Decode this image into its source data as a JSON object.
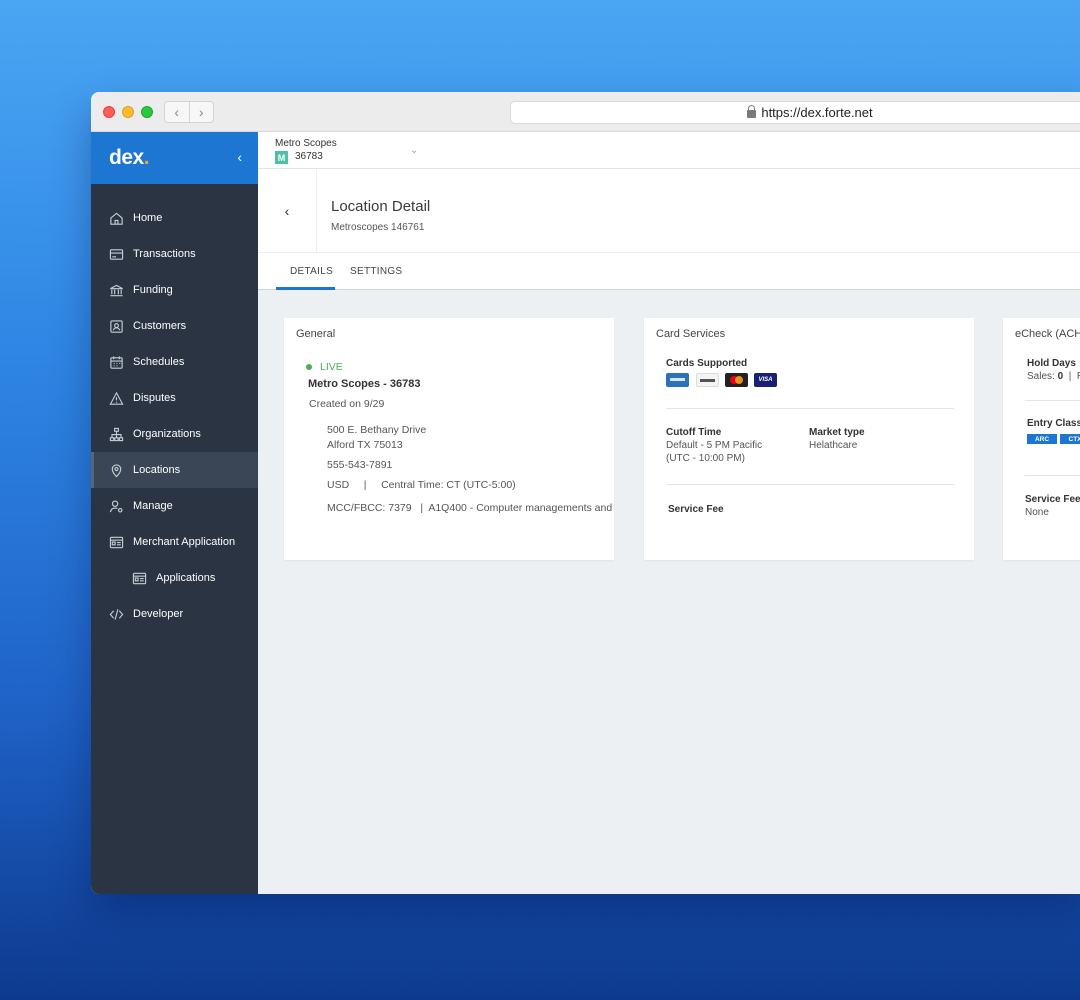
{
  "browser": {
    "url": "https://dex.forte.net",
    "back_glyph": "‹",
    "forward_glyph": "›"
  },
  "sidebar": {
    "brand": "dex",
    "brand_accent": ".",
    "collapse_glyph": "‹",
    "items": [
      {
        "label": "Home",
        "icon": "home-icon"
      },
      {
        "label": "Transactions",
        "icon": "credit-card-icon"
      },
      {
        "label": "Funding",
        "icon": "bank-icon"
      },
      {
        "label": "Customers",
        "icon": "contacts-icon"
      },
      {
        "label": "Schedules",
        "icon": "calendar-icon"
      },
      {
        "label": "Disputes",
        "icon": "warning-icon"
      },
      {
        "label": "Organizations",
        "icon": "hierarchy-icon"
      },
      {
        "label": "Locations",
        "icon": "map-pin-icon"
      },
      {
        "label": "Manage",
        "icon": "user-gear-icon"
      },
      {
        "label": "Merchant Application",
        "icon": "form-icon"
      },
      {
        "label": "Applications",
        "icon": "form-icon"
      },
      {
        "label": "Developer",
        "icon": "code-icon"
      }
    ],
    "active": "Locations"
  },
  "merchant": {
    "name": "Metro Scopes",
    "badge": "M",
    "id": "36783",
    "chevron": "⌄"
  },
  "header": {
    "back_glyph": "‹",
    "title": "Location Detail",
    "subtitle": "Metroscopes 146761"
  },
  "tabs": [
    {
      "label": "DETAILS",
      "active": true
    },
    {
      "label": "SETTINGS",
      "active": false
    }
  ],
  "general": {
    "title": "General",
    "status": "LIVE",
    "name": "Metro Scopes - 36783",
    "created": "Created on 9/29",
    "address1": "500 E. Bethany Drive",
    "address2": "Alford TX 75013",
    "phone": "555-543-7891",
    "currency_tz": "USD     |     Central Time: CT (UTC-5:00)",
    "mcc": "MCC/FBCC: 7379   |  A1Q400 - Computer managements and"
  },
  "card_services": {
    "title": "Card Services",
    "cards_label": "Cards Supported",
    "cards": [
      "amex",
      "discover",
      "mastercard",
      "visa"
    ],
    "visa_text": "VISA",
    "cutoff_label": "Cutoff Time",
    "cutoff_value1": "Default - 5 PM Pacific",
    "cutoff_value2": "(UTC - 10:00 PM)",
    "market_label": "Market type",
    "market_value": "Helathcare",
    "service_fee_label": "Service Fee"
  },
  "echeck": {
    "title": "eCheck (ACH",
    "hold_label": "Hold Days",
    "sales_prefix": "Sales: ",
    "sales_value": "0",
    "sales_suffix": "  |  R",
    "entry_label": "Entry Class",
    "tags": [
      "ARC",
      "CTX"
    ],
    "service_fee_label": "Service Fee",
    "service_fee_value": "None"
  },
  "colors": {
    "brand_blue": "#1c76d2",
    "sidebar_bg": "#2a3442",
    "live_green": "#4caf50",
    "brand_accent": "#f5a623"
  }
}
